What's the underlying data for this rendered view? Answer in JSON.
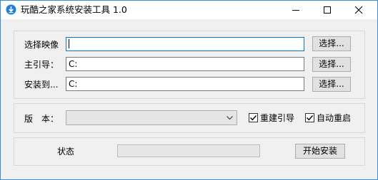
{
  "window": {
    "title": "玩酷之家系统安装工具 1.0",
    "icon": "download-arrow-icon",
    "accent": "#3f8cd6",
    "controls": [
      "minimize-icon",
      "maximize-icon",
      "close-icon"
    ]
  },
  "paths": {
    "image_label": "选择映像",
    "image_value": "",
    "boot_label": "主引导：",
    "boot_value": "C:",
    "install_label": "安装到...",
    "install_value": "C:",
    "browse_label": "选择..."
  },
  "options": {
    "version_label": "版　本：",
    "version_value": "",
    "rebuild_boot_label": "重建引导",
    "rebuild_boot_checked": true,
    "auto_restart_label": "自动重启",
    "auto_restart_checked": true
  },
  "status": {
    "label": "状态",
    "progress": 0,
    "start_label": "开始安装"
  }
}
